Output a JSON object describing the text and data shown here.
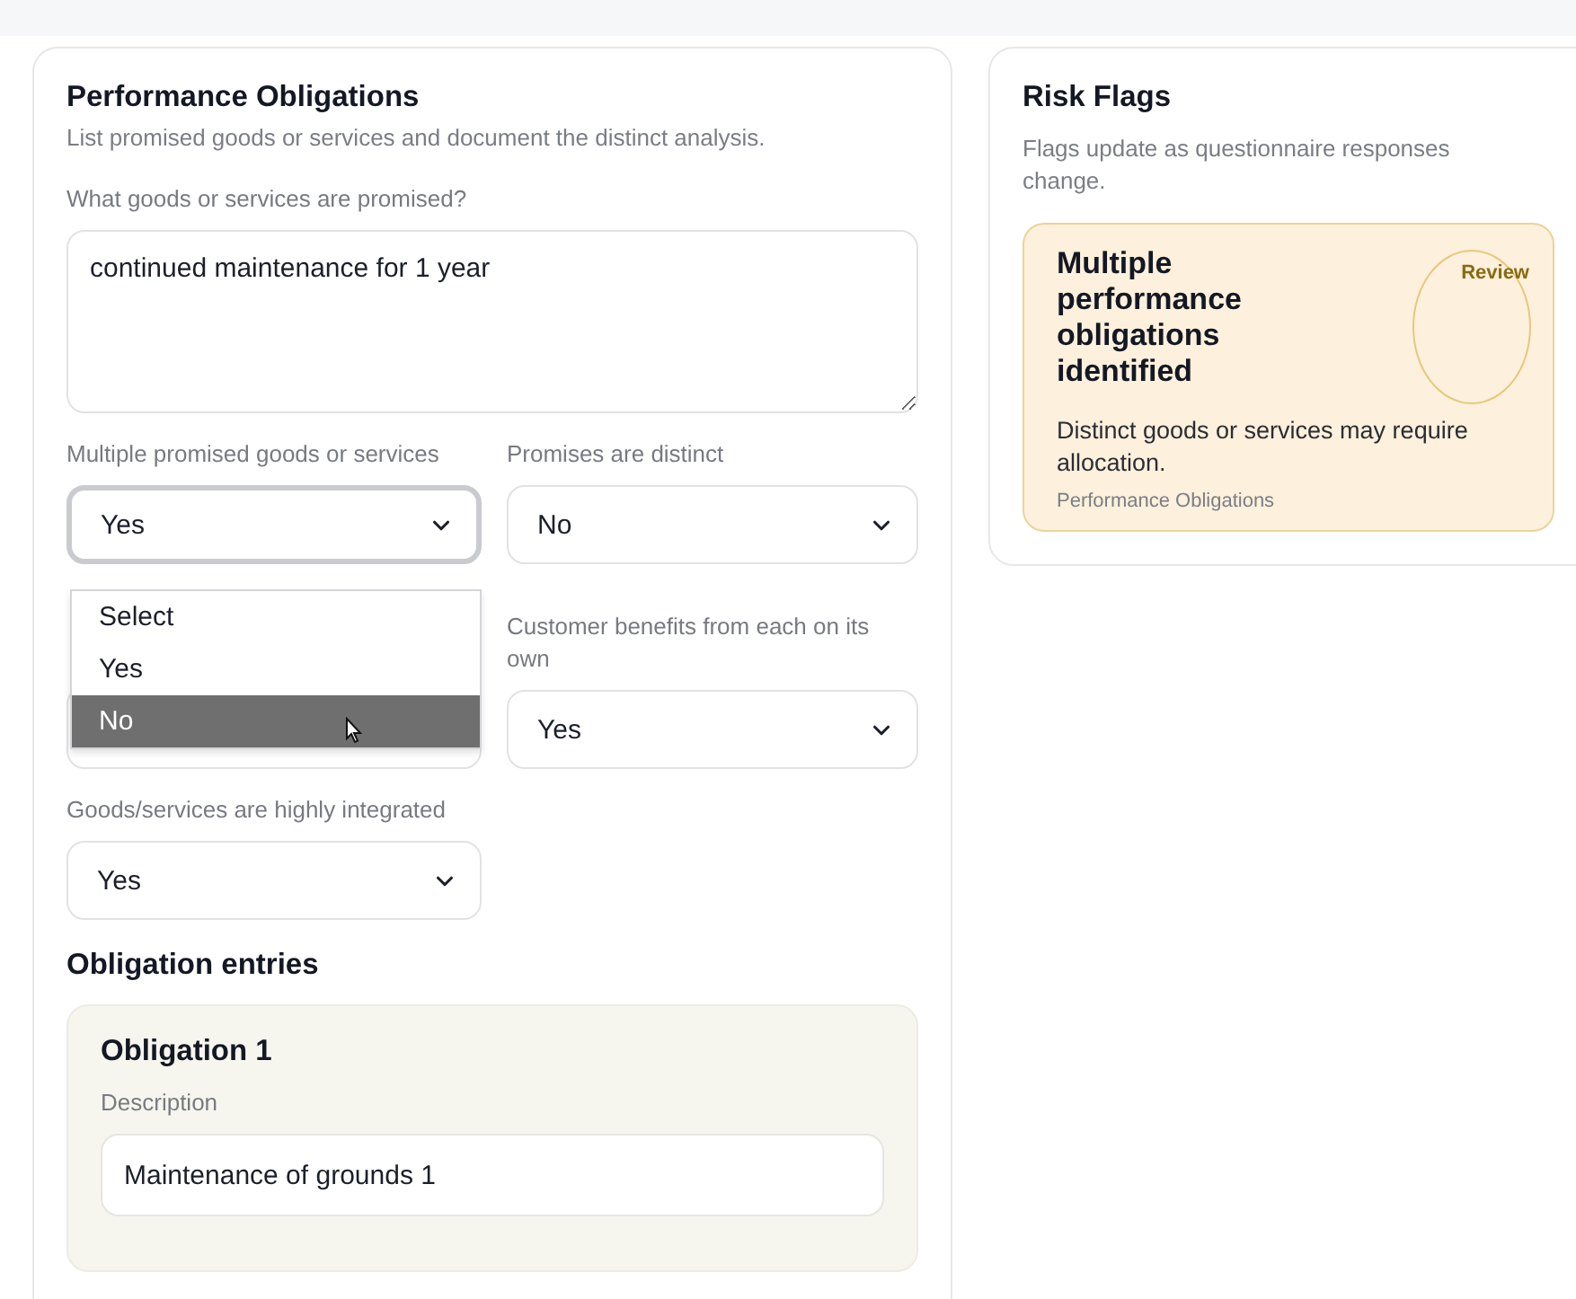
{
  "section": {
    "title": "Performance Obligations",
    "description": "List promised goods or services and document the distinct analysis.",
    "promised": {
      "label": "What goods or services are promised?",
      "value": "continued maintenance for 1 year"
    },
    "questions": [
      {
        "kind": "select",
        "label": "Multiple promised goods or services",
        "value": "Yes",
        "focused": true
      },
      {
        "kind": "select",
        "label": "Promises are distinct",
        "value": "No",
        "focused": false
      },
      {
        "kind": "covered"
      },
      {
        "kind": "select",
        "label": "Customer benefits from each on its own",
        "value": "Yes",
        "focused": false
      },
      {
        "kind": "select",
        "label": "Goods/services are highly integrated",
        "value": "Yes",
        "focused": false
      }
    ],
    "dropdown": {
      "options": [
        {
          "label": "Select",
          "selected": false
        },
        {
          "label": "Yes",
          "selected": false
        },
        {
          "label": "No",
          "selected": true
        }
      ]
    },
    "entries_title": "Obligation entries",
    "entries": [
      {
        "title": "Obligation 1",
        "description_label": "Description",
        "description": "Maintenance of grounds 1"
      }
    ]
  },
  "risk_flags": {
    "title": "Risk Flags",
    "description": "Flags update as questionnaire responses change.",
    "flags": [
      {
        "title": "Multiple performance obligations identified",
        "badge": "Review",
        "message": "Distinct goods or services may require allocation.",
        "source": "Performance Obligations"
      }
    ]
  }
}
